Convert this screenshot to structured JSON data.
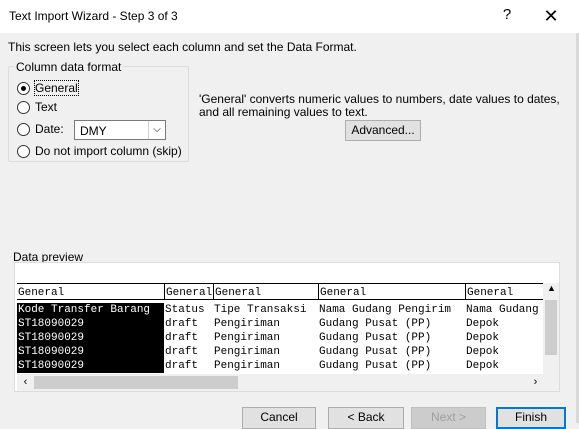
{
  "window": {
    "title": "Text Import Wizard - Step 3 of 3",
    "help": "?",
    "close": "✕"
  },
  "intro": "This screen lets you select each column and set the Data Format.",
  "column_format": {
    "legend": "Column data format",
    "options": [
      {
        "label": "General",
        "selected": true
      },
      {
        "label": "Text",
        "selected": false
      },
      {
        "label": "Date:",
        "selected": false
      },
      {
        "label": "Do not import column (skip)",
        "selected": false
      }
    ],
    "date_value": "DMY"
  },
  "description": "'General' converts numeric values to numbers, date values to dates, and all remaining values to text.",
  "advanced_button": "Advanced...",
  "preview": {
    "label": "Data preview",
    "formats": [
      "General",
      "General",
      "General",
      "General",
      "General"
    ],
    "rows": [
      [
        "Kode Transfer Barang",
        "Status",
        "Tipe Transaksi",
        "Nama Gudang Pengirim",
        "Nama Gudang"
      ],
      [
        "ST18090029",
        "draft",
        "Pengiriman",
        "Gudang Pusat (PP)",
        "Depok"
      ],
      [
        "ST18090029",
        "draft",
        "Pengiriman",
        "Gudang Pusat (PP)",
        "Depok"
      ],
      [
        "ST18090029",
        "draft",
        "Pengiriman",
        "Gudang Pusat (PP)",
        "Depok"
      ],
      [
        "ST18090029",
        "draft",
        "Pengiriman",
        "Gudang Pusat (PP)",
        "Depok"
      ]
    ]
  },
  "buttons": {
    "cancel": "Cancel",
    "back": "< Back",
    "next": "Next >",
    "finish": "Finish"
  }
}
